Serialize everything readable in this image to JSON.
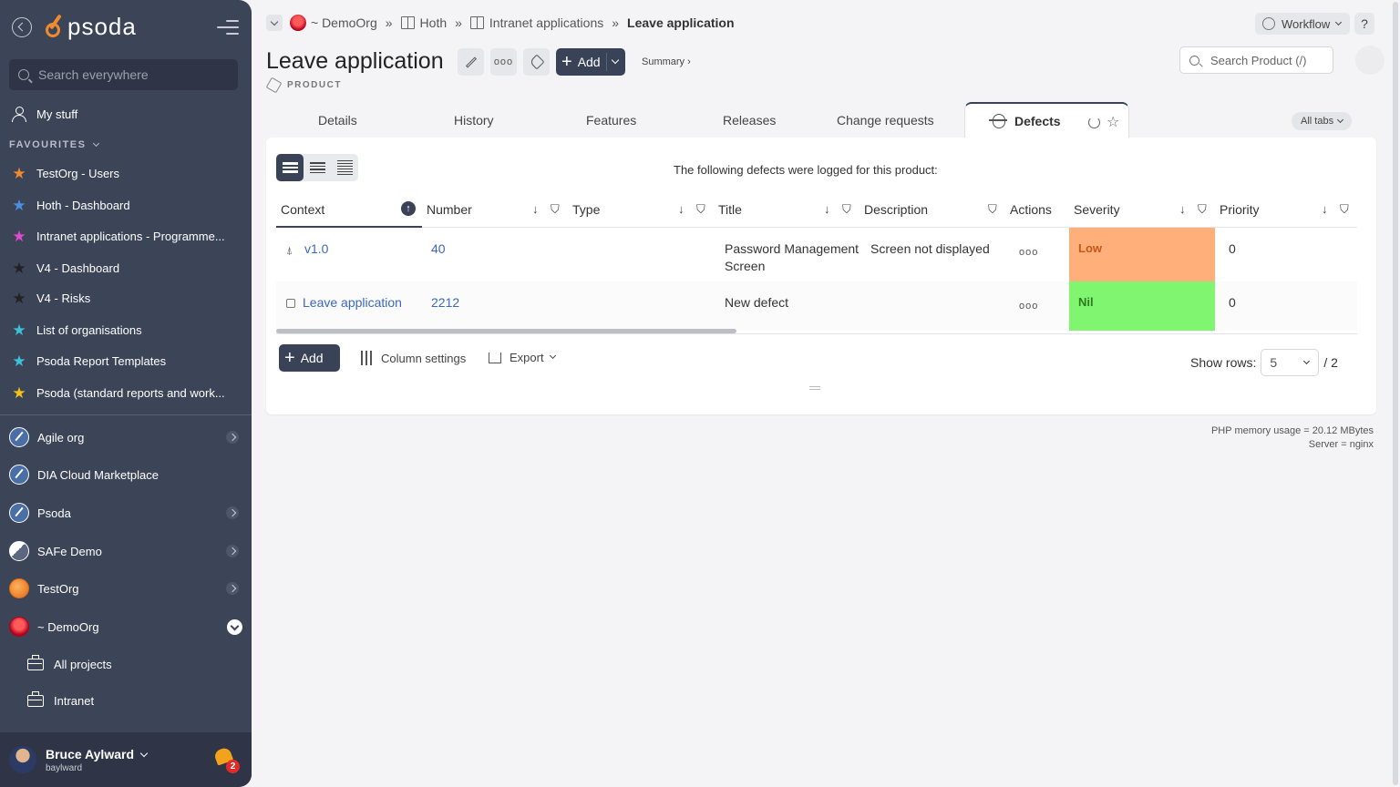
{
  "sidebar": {
    "logo_text": "psoda",
    "search_placeholder": "Search everywhere",
    "my_stuff": "My stuff",
    "favourites_header": "FAVOURITES",
    "favourites": [
      {
        "label": "TestOrg - Users",
        "star_color": "#f08a2e"
      },
      {
        "label": "Hoth - Dashboard",
        "star_color": "#4a8fe0"
      },
      {
        "label": "Intranet applications - Programme...",
        "star_color": "#e04ad0"
      },
      {
        "label": "V4 - Dashboard",
        "star_color": "#222222"
      },
      {
        "label": "V4 - Risks",
        "star_color": "#222222"
      },
      {
        "label": "List of organisations",
        "star_color": "#3cc2d8"
      },
      {
        "label": "Psoda Report Templates",
        "star_color": "#3cc2d8"
      },
      {
        "label": "Psoda (standard reports and work...",
        "star_color": "#f2c21b"
      }
    ],
    "orgs": [
      {
        "label": "Agile org",
        "has_children": true
      },
      {
        "label": "DIA Cloud Marketplace",
        "has_children": false
      },
      {
        "label": "Psoda",
        "has_children": true
      },
      {
        "label": "SAFe Demo",
        "has_children": true
      },
      {
        "label": "TestOrg",
        "has_children": true
      },
      {
        "label": "~ DemoOrg",
        "expanded": true
      }
    ],
    "sub_items": [
      "All projects",
      "Intranet"
    ],
    "user": {
      "name": "Bruce Aylward",
      "login": "baylward",
      "notifications": "2"
    }
  },
  "breadcrumb": {
    "org": "~ DemoOrg",
    "items": [
      "Hoth",
      "Intranet applications"
    ],
    "current": "Leave application"
  },
  "header": {
    "title": "Leave application",
    "type_label": "PRODUCT",
    "add_label": "Add",
    "summary_label": "Summary ›",
    "workflow_label": "Workflow",
    "help_label": "?",
    "search_placeholder": "Search Product (/)"
  },
  "tabs": [
    "Details",
    "History",
    "Features",
    "Releases",
    "Change requests"
  ],
  "active_tab": "Defects",
  "all_tabs_label": "All tabs",
  "defects": {
    "caption": "The following defects were logged for this product:",
    "columns": [
      "Context",
      "Number",
      "Type",
      "Title",
      "Description",
      "Actions",
      "Severity",
      "Priority"
    ],
    "rows": [
      {
        "context": "v1.0",
        "context_icon": "rocket-icon",
        "number": "40",
        "type": "",
        "title": "Password Management Screen",
        "description": "Screen not displayed",
        "actions": "ooo",
        "severity": "Low",
        "severity_color": "#ffb07a",
        "priority": "0"
      },
      {
        "context": "Leave application",
        "context_icon": "cube-icon",
        "number": "2212",
        "type": "",
        "title": "New defect",
        "description": "",
        "actions": "ooo",
        "severity": "Nil",
        "severity_color": "#80f570",
        "priority": "0"
      }
    ],
    "add_label": "Add",
    "column_settings_label": "Column settings",
    "export_label": "Export",
    "show_rows_label": "Show rows:",
    "rows_per_page": "5",
    "page_total": "/ 2"
  },
  "footer": {
    "memory": "PHP memory usage = 20.12 MBytes",
    "server": "Server = nginx"
  }
}
